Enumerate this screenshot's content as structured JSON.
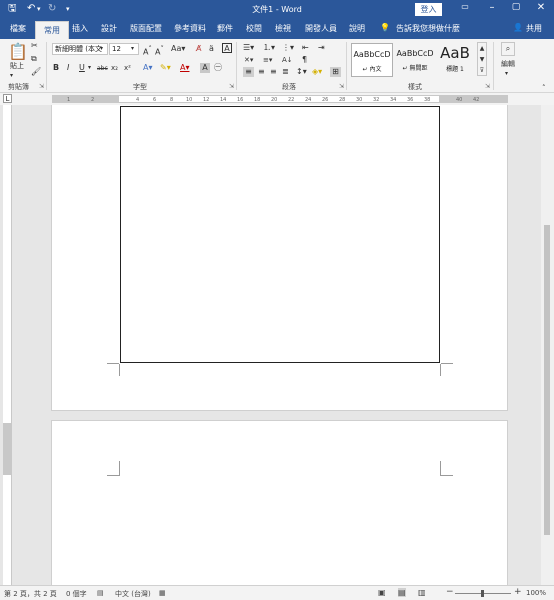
{
  "titlebar": {
    "title": "文件1 - Word",
    "sign_in": "登入",
    "icons": [
      "save-icon",
      "undo-icon",
      "redo-icon",
      "customize-icon"
    ],
    "window_icons": [
      "ribbon-options-icon",
      "minimize-icon",
      "maximize-icon",
      "close-icon"
    ]
  },
  "tabs": {
    "items": [
      "檔案",
      "常用",
      "插入",
      "設計",
      "版面配置",
      "參考資料",
      "郵件",
      "校閱",
      "檢視",
      "開發人員",
      "說明"
    ],
    "active": "常用",
    "tell_me": "告訴我您想做什麼",
    "share": "共用"
  },
  "ribbon": {
    "clipboard": {
      "paste": "貼上",
      "label": "剪貼簿"
    },
    "font": {
      "font_name": "新細明體 (本文",
      "font_size": "12",
      "label": "字型",
      "buttons": [
        "B",
        "I",
        "U",
        "abc",
        "x₂",
        "x²"
      ]
    },
    "paragraph": {
      "label": "段落"
    },
    "styles": {
      "label": "樣式",
      "items": [
        {
          "sample": "AaBbCcD",
          "name": "↵ 內文"
        },
        {
          "sample": "AaBbCcD",
          "name": "↵ 無間距"
        },
        {
          "sample": "AaB",
          "name": "標題 1"
        }
      ]
    },
    "editing": {
      "label": "編輯"
    }
  },
  "ruler": {
    "ticks": [
      "1",
      "2",
      "4",
      "6",
      "8",
      "10",
      "12",
      "14",
      "16",
      "18",
      "20",
      "22",
      "24",
      "26",
      "28",
      "30",
      "32",
      "34",
      "36",
      "38",
      "40",
      "42"
    ]
  },
  "status": {
    "page": "第 2 頁，共 2 頁",
    "words": "0 個字",
    "language": "中文 (台灣)",
    "zoom": "100%",
    "zoom_minus": "−",
    "zoom_plus": "+"
  }
}
